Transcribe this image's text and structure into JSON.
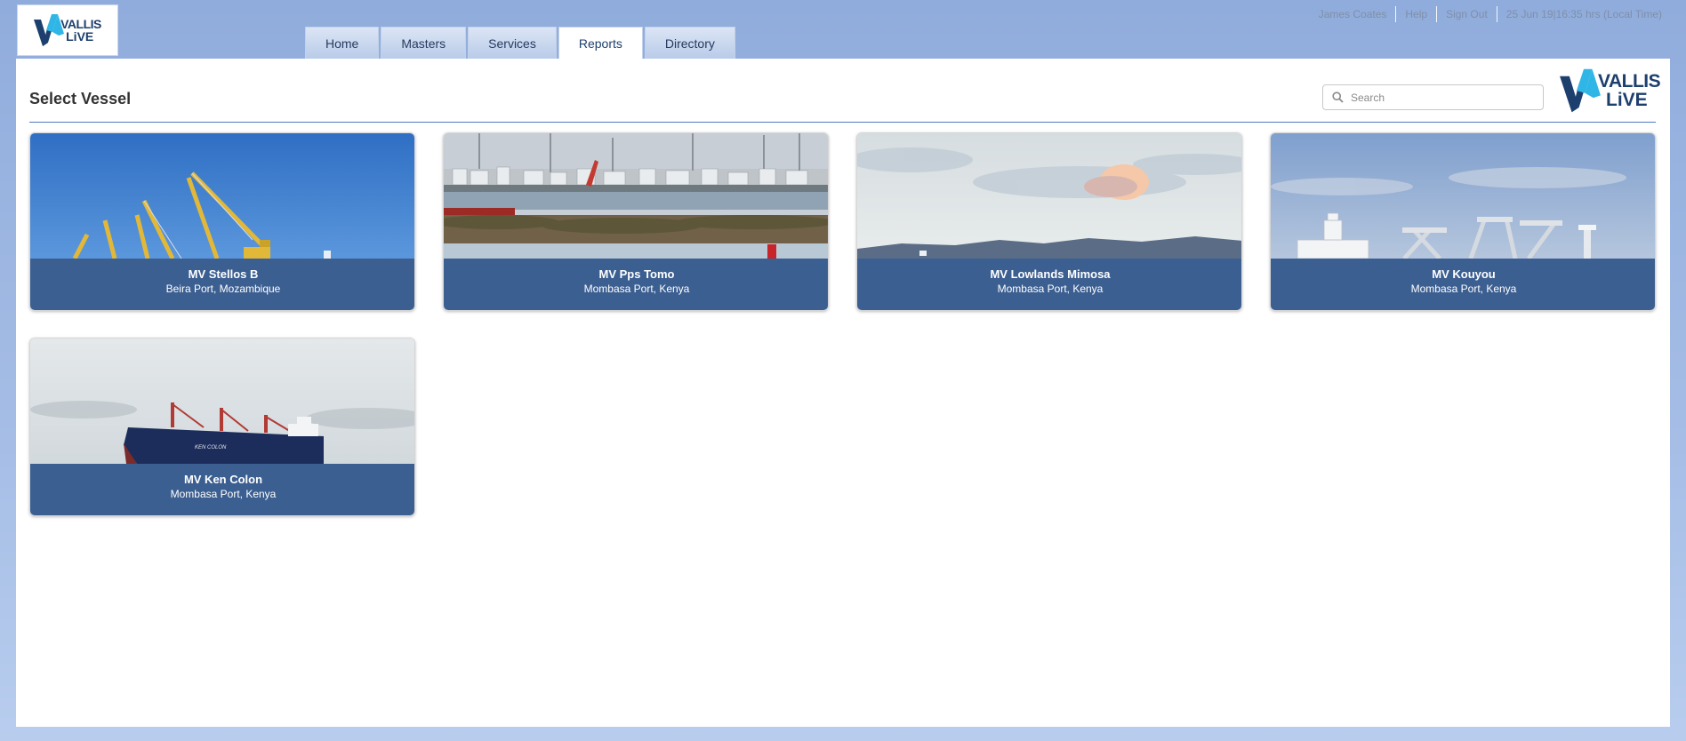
{
  "brand": {
    "line1": "VALLIS",
    "line2": "LiVE"
  },
  "nav": {
    "tabs": [
      {
        "label": "Home"
      },
      {
        "label": "Masters"
      },
      {
        "label": "Services"
      },
      {
        "label": "Reports",
        "active": true
      },
      {
        "label": "Directory"
      }
    ]
  },
  "userbar": {
    "user": "James Coates",
    "help": "Help",
    "signout": "Sign Out",
    "datetime": "25 Jun 19|16:35 hrs (Local Time)"
  },
  "page": {
    "title": "Select Vessel"
  },
  "search": {
    "placeholder": "Search",
    "icon": "search-icon"
  },
  "vessels": [
    {
      "name": "MV Stellos B",
      "port": "Beira Port, Mozambique"
    },
    {
      "name": "MV Pps Tomo",
      "port": "Mombasa Port, Kenya"
    },
    {
      "name": "MV Lowlands Mimosa",
      "port": "Mombasa Port, Kenya"
    },
    {
      "name": "MV Kouyou",
      "port": "Mombasa Port, Kenya"
    },
    {
      "name": "MV Ken Colon",
      "port": "Mombasa Port, Kenya"
    }
  ],
  "colors": {
    "accent": "#3c5f91",
    "background": "#90acdc",
    "rule": "#4d7bc0"
  }
}
